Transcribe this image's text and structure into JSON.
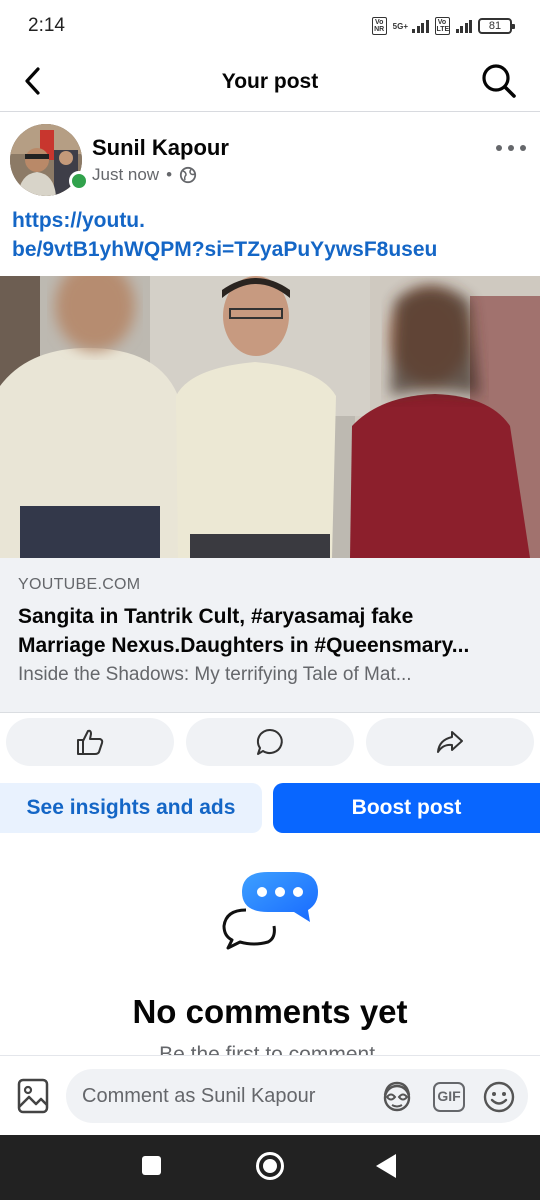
{
  "status_bar": {
    "time": "2:14",
    "sim1_label": "Vo NR",
    "network_type": "5G+",
    "sim2_label": "Vo LTE",
    "battery": "81"
  },
  "header": {
    "title": "Your post",
    "back_icon": "chevron-left-icon",
    "search_icon": "search-icon"
  },
  "post": {
    "author": "Sunil Kapour",
    "time": "Just now",
    "separator": "•",
    "privacy_icon": "globe-icon",
    "link_line1": "https://youtu.",
    "link_line2": "be/9vtB1yhWQPM?si=TZyaPuYywsF8useu",
    "preview": {
      "domain": "YOUTUBE.COM",
      "title_line1": "Sangita in Tantrik Cult, #aryasamaj fake",
      "title_line2": "Marriage Nexus.Daughters in #Queensmary...",
      "description": "Inside the Shadows: My terrifying Tale of Mat..."
    }
  },
  "actions": {
    "like_icon": "thumbs-up-icon",
    "comment_icon": "comment-icon",
    "share_icon": "share-icon"
  },
  "cta": {
    "insights": "See insights and ads",
    "boost": "Boost post"
  },
  "comments": {
    "empty_title": "No comments yet",
    "empty_subtitle": "Be the first to comment."
  },
  "composer": {
    "placeholder": "Comment as Sunil Kapour",
    "gif_label": "GIF"
  },
  "colors": {
    "brand_blue": "#0866ff",
    "link_blue": "#1466c6",
    "online_green": "#31a24c"
  }
}
